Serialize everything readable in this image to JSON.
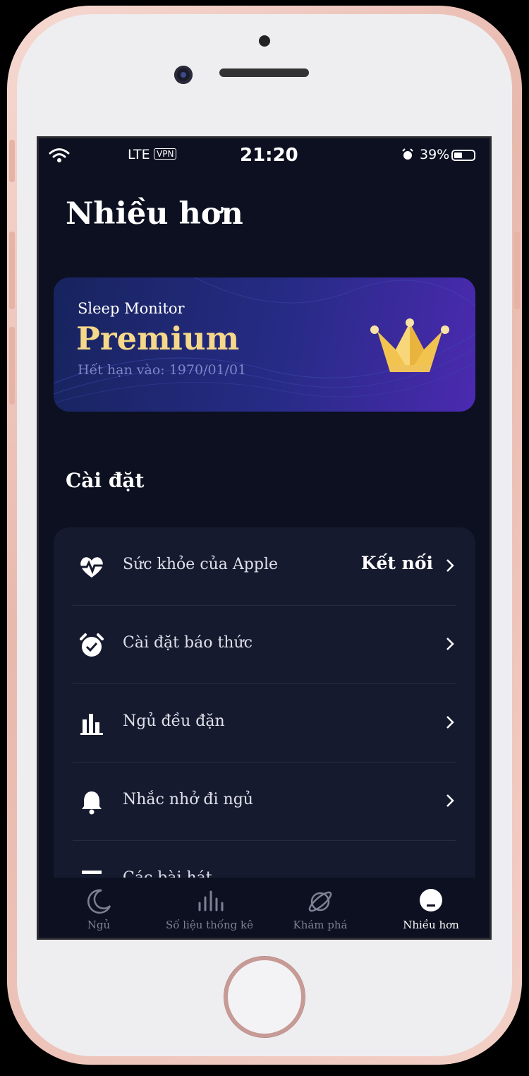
{
  "status_bar": {
    "carrier": "LTE",
    "vpn": "VPN",
    "time": "21:20",
    "battery": "39%"
  },
  "page": {
    "title": "Nhiều hơn"
  },
  "premium": {
    "app_name": "Sleep Monitor",
    "tier": "Premium",
    "expires": "Hết hạn vào: 1970/01/01"
  },
  "settings": {
    "heading": "Cài đặt",
    "rows": [
      {
        "icon": "heart-pulse-icon",
        "label": "Sức khỏe của Apple",
        "value": "Kết nối"
      },
      {
        "icon": "alarm-clock-icon",
        "label": "Cài đặt báo thức"
      },
      {
        "icon": "bar-chart-icon",
        "label": "Ngủ đều đặn"
      },
      {
        "icon": "bell-icon",
        "label": "Nhắc nhở đi ngủ"
      },
      {
        "icon": "list-icon",
        "label": "Các bài hát"
      }
    ]
  },
  "tabs": [
    {
      "icon": "moon-icon",
      "label": "Ngủ"
    },
    {
      "icon": "stats-icon",
      "label": "Số liệu thống kê"
    },
    {
      "icon": "planet-icon",
      "label": "Khám phá"
    },
    {
      "icon": "lamp-icon",
      "label": "Nhiều hơn",
      "active": true
    }
  ],
  "colors": {
    "background": "#0c1020",
    "card": "#161a2e",
    "premium_gold": "#f5d889",
    "premium_gradient_end": "#4b2ab0"
  }
}
